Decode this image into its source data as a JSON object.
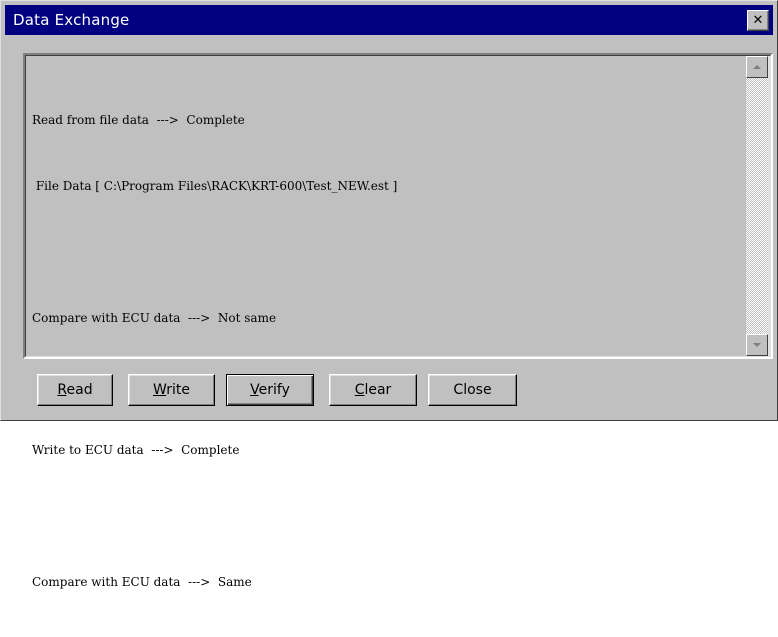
{
  "window": {
    "title": "Data Exchange",
    "close_label": "✕"
  },
  "log": {
    "lines": [
      "Read from file data  --->  Complete",
      " File Data [ C:\\Program Files\\RACK\\KRT-600\\Test_NEW.est ]",
      "",
      "Compare with ECU data  --->  Not same",
      "",
      "Write to ECU data  --->  Complete",
      "",
      "Compare with ECU data  --->  Same"
    ]
  },
  "buttons": {
    "read": {
      "mnemonic": "R",
      "rest": "ead"
    },
    "write": {
      "mnemonic": "W",
      "rest": "rite"
    },
    "verify": {
      "mnemonic": "V",
      "rest": "erify"
    },
    "clear": {
      "mnemonic": "C",
      "rest": "lear"
    },
    "close": {
      "label": "Close"
    }
  }
}
